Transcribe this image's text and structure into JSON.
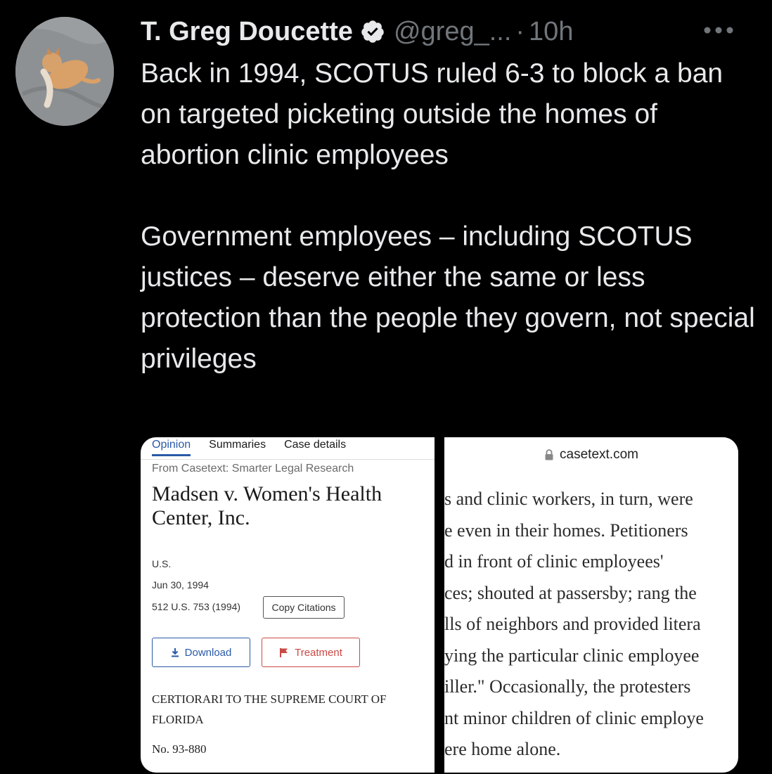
{
  "tweet": {
    "author_name": "T. Greg Doucette",
    "handle": "@greg_...",
    "separator": "·",
    "time": "10h",
    "icons": {
      "verified": "verified-badge-icon",
      "more": "more-options-icon"
    },
    "paragraph1": "Back in 1994, SCOTUS ruled 6-3 to block a ban on targeted picketing outside the homes of abortion clinic employees",
    "paragraph2": "Government employees – including SCOTUS justices – deserve either the same or less protection than the people they govern, not special privileges"
  },
  "left_panel": {
    "tabs": [
      "Opinion",
      "Summaries",
      "Case details"
    ],
    "source": "From Casetext: Smarter Legal Research",
    "case_title": "Madsen v. Women's Health Center, Inc.",
    "court": "U.S.",
    "date": "Jun 30, 1994",
    "citation": "512 U.S. 753 (1994)",
    "copy_citations": "Copy Citations",
    "download": "Download",
    "treatment": "Treatment",
    "certiorari": "CERTIORARI TO THE SUPREME COURT OF FLORIDA",
    "docket": "No. 93-880"
  },
  "right_panel": {
    "url": "casetext.com",
    "excerpt_lines": [
      "s and clinic workers, in turn, were",
      "e even in their homes. Petitioners",
      "d in front of clinic employees'",
      "ces; shouted at passersby; rang the",
      "lls of neighbors and provided litera",
      "ying the particular clinic employee",
      "iller.\" Occasionally, the protesters",
      "nt minor children of clinic employe",
      "ere home alone."
    ]
  },
  "colors": {
    "background": "#000000",
    "text": "#e7e9ea",
    "secondary_text": "#71767b",
    "link_blue": "#2a5aa7",
    "treatment_red": "#c94a45"
  }
}
